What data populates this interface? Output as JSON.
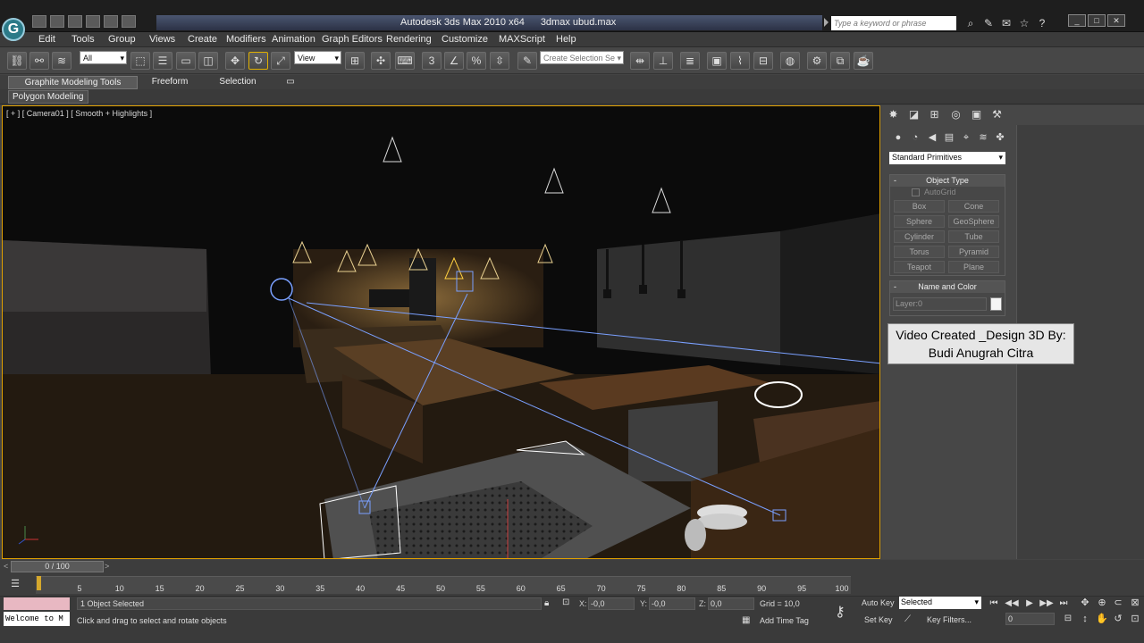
{
  "window": {
    "app_name": "Autodesk 3ds Max  2010 x64",
    "file_name": "3dmax ubud.max",
    "search_placeholder": "Type a keyword or phrase"
  },
  "menu": [
    "Edit",
    "Tools",
    "Group",
    "Views",
    "Create",
    "Modifiers",
    "Animation",
    "Graph Editors",
    "Rendering",
    "Customize",
    "MAXScript",
    "Help"
  ],
  "toolbar": {
    "selection_filter": "All",
    "reference_coord": "View",
    "named_selection_placeholder": "Create Selection Se"
  },
  "ribbon": {
    "tabs": [
      "Graphite Modeling Tools",
      "Freeform",
      "Selection"
    ],
    "panel_button": "Polygon Modeling"
  },
  "viewport": {
    "label": "[ + ] [ Camera01 ] [ Smooth + Highlights ]"
  },
  "overlay": {
    "line1": "Video Created  _Design 3D By:",
    "line2": "Budi Anugrah Citra"
  },
  "command_panel": {
    "category": "Standard Primitives",
    "object_type_title": "Object Type",
    "autogrid_label": "AutoGrid",
    "primitives": [
      "Box",
      "Cone",
      "Sphere",
      "GeoSphere",
      "Cylinder",
      "Tube",
      "Torus",
      "Pyramid",
      "Teapot",
      "Plane"
    ],
    "name_color_title": "Name and Color",
    "name_value": "Layer:0"
  },
  "timeline": {
    "frame_display": "0 / 100",
    "ticks": [
      "5",
      "10",
      "15",
      "20",
      "25",
      "30",
      "35",
      "40",
      "45",
      "50",
      "55",
      "60",
      "65",
      "70",
      "75",
      "80",
      "85",
      "90",
      "95",
      "100"
    ]
  },
  "status": {
    "maxscript_listener": "Welcome to M",
    "selection_status": "1 Object Selected",
    "prompt": "Click and drag to select and rotate objects",
    "x_label": "X:",
    "x_value": "-0,0",
    "y_label": "Y:",
    "y_value": "-0,0",
    "z_label": "Z:",
    "z_value": "0,0",
    "grid": "Grid = 10,0",
    "add_time_tag": "Add Time Tag",
    "auto_key": "Auto Key",
    "set_key": "Set Key",
    "selected_dropdown": "Selected",
    "key_filters": "Key Filters...",
    "current_frame": "0"
  },
  "colors": {
    "viewport_border": "#e0a000",
    "track_key": "#d4a72c",
    "maxscript_pink": "#e8b8c2"
  }
}
